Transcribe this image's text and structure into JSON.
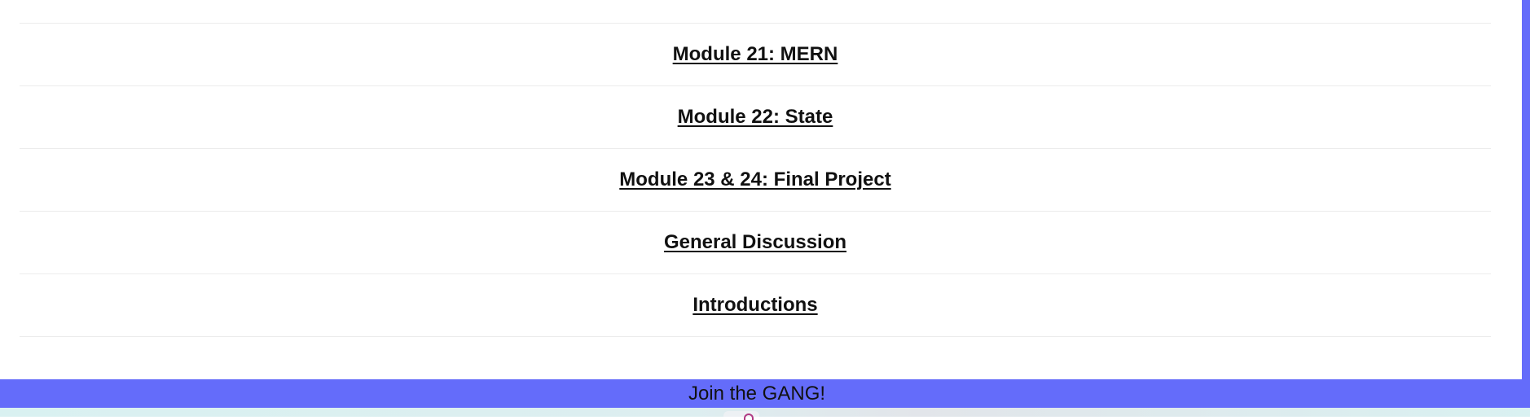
{
  "list": {
    "items": [
      {
        "label": "Module 21: MERN"
      },
      {
        "label": "Module 22: State"
      },
      {
        "label": "Module 23 & 24: Final Project"
      },
      {
        "label": "General Discussion"
      },
      {
        "label": "Introductions"
      }
    ]
  },
  "footer": {
    "text": "Join the GANG!"
  },
  "colors": {
    "accent": "#646cfa",
    "text": "#111111",
    "divider": "#ececec"
  },
  "icons": {
    "bottom_icon": "brand-icon"
  }
}
